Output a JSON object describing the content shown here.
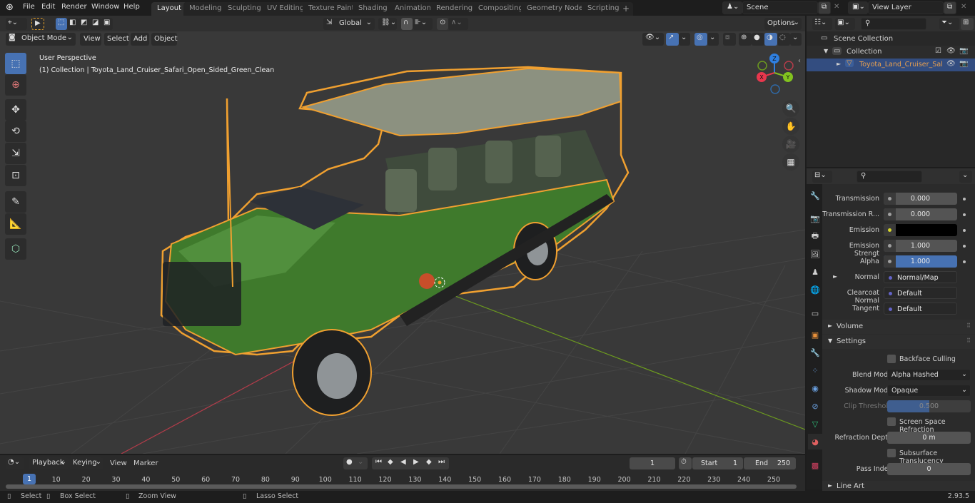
{
  "topbar": {
    "menus": [
      "File",
      "Edit",
      "Render",
      "Window",
      "Help"
    ],
    "workspaces": [
      "Layout",
      "Modeling",
      "Sculpting",
      "UV Editing",
      "Texture Paint",
      "Shading",
      "Animation",
      "Rendering",
      "Compositing",
      "Geometry Nodes",
      "Scripting"
    ],
    "active_workspace": "Layout",
    "add_workspace": "+",
    "scene": "Scene",
    "view_layer": "View Layer"
  },
  "viewport": {
    "mode": "Object Mode",
    "menus": [
      "View",
      "Select",
      "Add",
      "Object"
    ],
    "orientation": "Global",
    "options_label": "Options",
    "overlay_title": "User Perspective",
    "overlay_subtitle": "(1) Collection | Toyota_Land_Cruiser_Safari_Open_Sided_Green_Clean",
    "gizmo_axes": {
      "z": "Z",
      "x": "X",
      "y": "Y"
    },
    "tools": [
      "select-box",
      "cursor",
      "move",
      "rotate",
      "scale",
      "transform",
      "annotate",
      "measure",
      "add-cube"
    ],
    "nav_buttons": [
      "zoom",
      "pan",
      "camera",
      "grid"
    ]
  },
  "outliner": {
    "scene_collection": "Scene Collection",
    "collection": "Collection",
    "object": "Toyota_Land_Cruiser_Sal"
  },
  "properties": {
    "rows": [
      {
        "label": "Transmission",
        "value": "0.000",
        "type": "slider",
        "socket": "#a0a0a0"
      },
      {
        "label": "Transmission R...",
        "value": "0.000",
        "type": "slider",
        "socket": "#a0a0a0"
      },
      {
        "label": "Emission",
        "value": "",
        "type": "color",
        "socket": "#d6d62a",
        "color": "#000000"
      },
      {
        "label": "Emission Strengt",
        "value": "1.000",
        "type": "slider",
        "socket": "#a0a0a0"
      },
      {
        "label": "Alpha",
        "value": "1.000",
        "type": "slider-full",
        "socket": "#a0a0a0"
      },
      {
        "label": "Normal",
        "value": "Normal/Map",
        "type": "link",
        "socket": "#6363c7"
      },
      {
        "label": "Clearcoat Normal",
        "value": "Default",
        "type": "link",
        "socket": "#6363c7"
      },
      {
        "label": "Tangent",
        "value": "Default",
        "type": "link",
        "socket": "#6363c7"
      }
    ],
    "volume_panel": "Volume",
    "settings_panel": "Settings",
    "backface_culling": "Backface Culling",
    "blend_mode_label": "Blend Mode",
    "blend_mode": "Alpha Hashed",
    "shadow_mode_label": "Shadow Mode",
    "shadow_mode": "Opaque",
    "clip_threshold_label": "Clip Threshold",
    "clip_threshold": "0.500",
    "clip_threshold_fraction": 0.5,
    "ss_refraction": "Screen Space Refraction",
    "refraction_depth_label": "Refraction Depth",
    "refraction_depth": "0 m",
    "subsurface_translucency": "Subsurface Translucency",
    "pass_index_label": "Pass Index",
    "pass_index": "0",
    "line_art_panel": "Line Art"
  },
  "timeline": {
    "menus": [
      "Playback",
      "Keying",
      "View",
      "Marker"
    ],
    "current_frame": "1",
    "start_label": "Start",
    "start": "1",
    "end_label": "End",
    "end": "250",
    "ticks": [
      "10",
      "20",
      "30",
      "40",
      "50",
      "60",
      "70",
      "80",
      "90",
      "100",
      "110",
      "120",
      "130",
      "140",
      "150",
      "160",
      "170",
      "180",
      "190",
      "200",
      "210",
      "220",
      "230",
      "240",
      "250"
    ],
    "playhead": "1"
  },
  "statusbar": {
    "select": "Select",
    "box_select": "Box Select",
    "zoom_view": "Zoom View",
    "lasso_select": "Lasso Select",
    "version": "2.93.5"
  },
  "colors": {
    "accent": "#4772b3",
    "selection_outline": "#f0a030",
    "x_axis": "#e8374d",
    "y_axis": "#82c21f",
    "z_axis": "#2f7fe0"
  }
}
